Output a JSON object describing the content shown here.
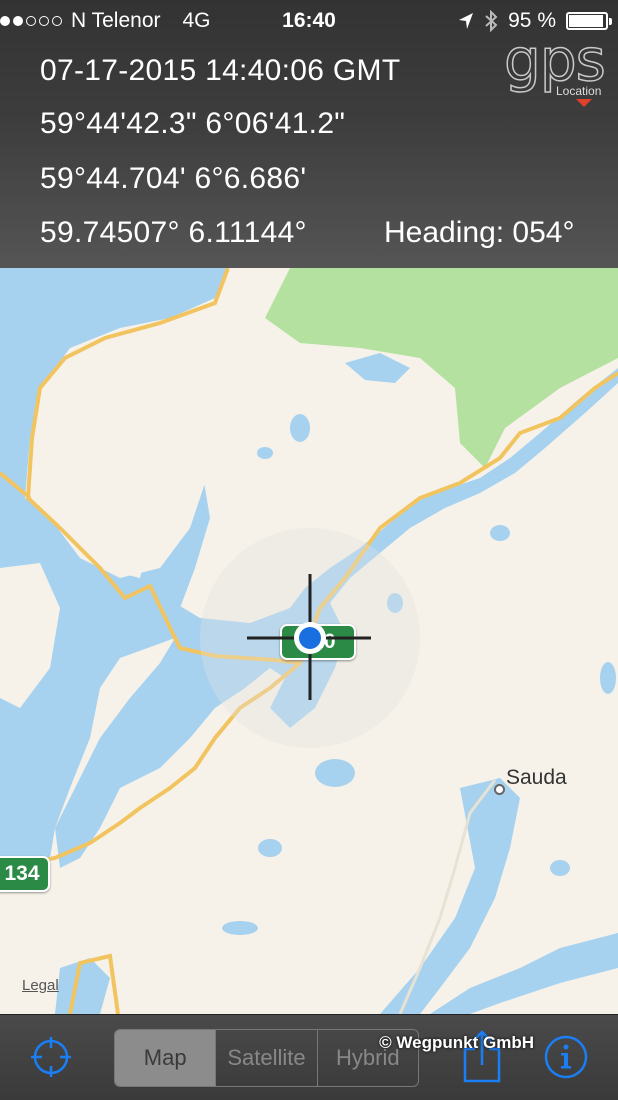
{
  "status_bar": {
    "carrier": "N Telenor",
    "network": "4G",
    "time": "16:40",
    "battery": "95 %",
    "battery_level": 0.95,
    "signal_bars": 2
  },
  "info": {
    "datetime": "07-17-2015  14:40:06 GMT",
    "dms": "59°44'42.3\" 6°06'41.2\"",
    "ddm": "59°44.704' 6°6.686'",
    "decimal": "59.74507° 6.11144°",
    "heading": "Heading: 054°"
  },
  "logo": {
    "text": "gps",
    "sub": "Location"
  },
  "map": {
    "place_label": "Sauda",
    "route_shield_1": "134",
    "route_shield_2": "520",
    "legal": "Legal"
  },
  "toolbar": {
    "segments": [
      "Map",
      "Satellite",
      "Hybrid"
    ],
    "selected": "Map",
    "copyright": "© Wegpunkt GmbH"
  },
  "colors": {
    "water": "#a6d2f0",
    "land": "#f6f2e9",
    "forest": "#b4e1a0",
    "road": "#f2c460",
    "accent": "#1a7ef5"
  }
}
